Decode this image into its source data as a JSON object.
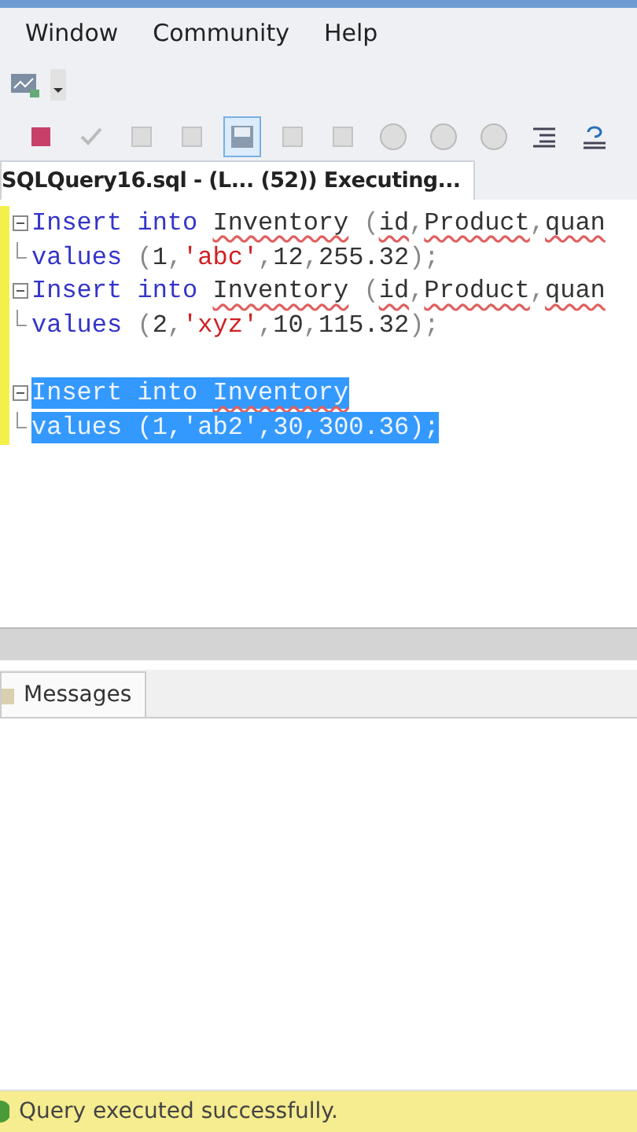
{
  "menu": [
    {
      "label": "Window"
    },
    {
      "label": "Community"
    },
    {
      "label": "Help"
    }
  ],
  "toolbar": [
    {
      "kind": "stop"
    },
    {
      "kind": "check"
    },
    {
      "kind": "grey"
    },
    {
      "kind": "grey"
    },
    {
      "kind": "save",
      "selected": true
    },
    {
      "kind": "grey"
    },
    {
      "kind": "grey"
    },
    {
      "kind": "round"
    },
    {
      "kind": "round"
    },
    {
      "kind": "round"
    },
    {
      "kind": "indent"
    },
    {
      "kind": "undo"
    }
  ],
  "editor_tab": {
    "title": "SQLQuery16.sql - (L... (52)) Executing..."
  },
  "code_lines": [
    {
      "kind": "start",
      "selected": false,
      "tokens": [
        {
          "text": "Insert into ",
          "kind": "keyword"
        },
        {
          "text": "Inventory",
          "kind": "ident"
        },
        {
          "text": " (",
          "kind": "punct"
        },
        {
          "text": "id",
          "kind": "ident"
        },
        {
          "text": ",",
          "kind": "punct"
        },
        {
          "text": "Product",
          "kind": "ident"
        },
        {
          "text": ",",
          "kind": "punct"
        },
        {
          "text": "quan",
          "kind": "ident"
        }
      ]
    },
    {
      "kind": "end",
      "selected": false,
      "tokens": [
        {
          "text": "values",
          "kind": "keyword"
        },
        {
          "text": " (",
          "kind": "punct"
        },
        {
          "text": "1",
          "kind": "plain"
        },
        {
          "text": ",",
          "kind": "punct"
        },
        {
          "text": "'abc'",
          "kind": "string"
        },
        {
          "text": ",",
          "kind": "punct"
        },
        {
          "text": "12",
          "kind": "plain"
        },
        {
          "text": ",",
          "kind": "punct"
        },
        {
          "text": "255.32",
          "kind": "plain"
        },
        {
          "text": ");",
          "kind": "punct"
        }
      ]
    },
    {
      "kind": "start",
      "selected": false,
      "tokens": [
        {
          "text": "Insert into ",
          "kind": "keyword"
        },
        {
          "text": "Inventory",
          "kind": "ident"
        },
        {
          "text": " (",
          "kind": "punct"
        },
        {
          "text": "id",
          "kind": "ident"
        },
        {
          "text": ",",
          "kind": "punct"
        },
        {
          "text": "Product",
          "kind": "ident"
        },
        {
          "text": ",",
          "kind": "punct"
        },
        {
          "text": "quan",
          "kind": "ident"
        }
      ]
    },
    {
      "kind": "end",
      "selected": false,
      "tokens": [
        {
          "text": "values",
          "kind": "keyword"
        },
        {
          "text": " (",
          "kind": "punct"
        },
        {
          "text": "2",
          "kind": "plain"
        },
        {
          "text": ",",
          "kind": "punct"
        },
        {
          "text": "'xyz'",
          "kind": "string"
        },
        {
          "text": ",",
          "kind": "punct"
        },
        {
          "text": "10",
          "kind": "plain"
        },
        {
          "text": ",",
          "kind": "punct"
        },
        {
          "text": "115.32",
          "kind": "plain"
        },
        {
          "text": ");",
          "kind": "punct"
        }
      ]
    },
    {
      "selected": false
    },
    {
      "kind": "start",
      "selected": true,
      "tokens": [
        {
          "text": "Insert into ",
          "kind": "keyword"
        },
        {
          "text": "Inventory",
          "kind": "ident"
        }
      ]
    },
    {
      "kind": "end",
      "selected": true,
      "tokens": [
        {
          "text": "values",
          "kind": "keyword"
        },
        {
          "text": " (",
          "kind": "punct"
        },
        {
          "text": "1",
          "kind": "plain"
        },
        {
          "text": ",",
          "kind": "punct"
        },
        {
          "text": "'ab2'",
          "kind": "string"
        },
        {
          "text": ",",
          "kind": "punct"
        },
        {
          "text": "30",
          "kind": "plain"
        },
        {
          "text": ",",
          "kind": "punct"
        },
        {
          "text": "300.36",
          "kind": "plain"
        },
        {
          "text": ");",
          "kind": "punct"
        }
      ]
    }
  ],
  "results_tabs": [
    {
      "label": "Messages",
      "selected": true
    }
  ],
  "status_bar": {
    "text": "Query executed successfully."
  }
}
